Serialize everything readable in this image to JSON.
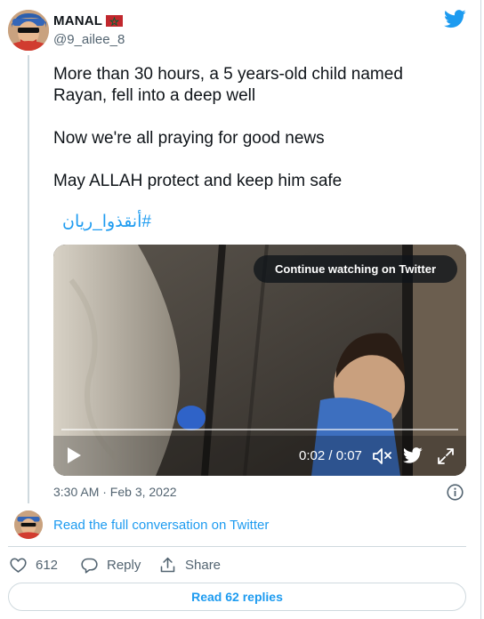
{
  "author": {
    "display_name": "MANAL",
    "handle": "@9_ailee_8",
    "avatar": "profile-photo",
    "flag": "morocco-flag"
  },
  "tweet": {
    "line1": "More than 30 hours, a 5 years-old child named",
    "line2": "Rayan, fell into a deep well",
    "line3": "Now we're all praying for good news",
    "line4": "May ALLAH protect and keep him safe",
    "hashtag": "#أنقذوا_ريان"
  },
  "video": {
    "continue_label": "Continue watching on Twitter",
    "time_readout": "0:02 / 0:07",
    "progress": 0.0,
    "icons": [
      "play-icon",
      "volume-icon",
      "twitter-bird-icon",
      "expand-icon"
    ]
  },
  "meta": {
    "timestamp": "3:30 AM · Feb 3, 2022",
    "info_icon": "info-icon"
  },
  "conversation": {
    "link_label": "Read the full conversation on Twitter"
  },
  "actions": {
    "like_count": "612",
    "reply_label": "Reply",
    "share_label": "Share"
  },
  "replies": {
    "button_label": "Read 62 replies"
  },
  "colors": {
    "accent": "#1d9bf0",
    "text": "#0f1419",
    "secondary": "#536471",
    "border": "#cfd9de",
    "flag_red": "#c1272d",
    "flag_green": "#006233"
  }
}
